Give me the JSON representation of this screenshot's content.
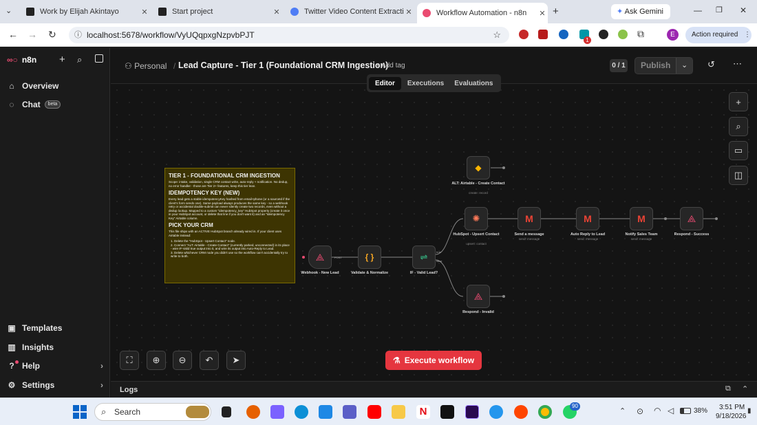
{
  "browser": {
    "tabs": [
      {
        "label": "Work by Elijah Akintayo",
        "icon": "layout-icon"
      },
      {
        "label": "Start project",
        "icon": "layout-icon"
      },
      {
        "label": "Twitter Video Content Extractio",
        "icon": "gemini-icon"
      },
      {
        "label": "Workflow Automation - n8n",
        "icon": "n8n-icon"
      }
    ],
    "ask_gemini": "Ask Gemini",
    "url": "localhost:5678/workflow/VyUQqpxgNzpvbPJT",
    "profile_initial": "E",
    "action_required": "Action required",
    "ext_badge": "1"
  },
  "colors": {
    "accent": "#ea4b71",
    "execute": "#e5363f",
    "note_bg": "#3d3402"
  },
  "sidebar": {
    "logo": "n8n",
    "items": [
      {
        "label": "Overview",
        "icon": "home-icon"
      },
      {
        "label": "Chat",
        "icon": "chat-icon"
      }
    ],
    "beta": "beta",
    "bottom": [
      {
        "label": "Templates",
        "icon": "templates-icon"
      },
      {
        "label": "Insights",
        "icon": "insights-icon"
      },
      {
        "label": "Help",
        "icon": "help-icon"
      },
      {
        "label": "Settings",
        "icon": "settings-icon"
      }
    ]
  },
  "header": {
    "project": "Personal",
    "workflow_name": "Lead Capture - Tier 1 (Foundational CRM Ingestion)",
    "add_tag": "+ Add tag",
    "counter": "0 / 1",
    "publish": "Publish",
    "tabs": [
      "Editor",
      "Executions",
      "Evaluations"
    ],
    "active_tab": "Editor"
  },
  "note": {
    "h1": "TIER 1 - FOUNDATIONAL CRM INGESTION",
    "p1": "Scope: intake, validation, single CRM contact write, auto-reply + notification. No dedup, no error handler - those are Tier 2+ features, keep this tier lean.",
    "h2": "IDEMPOTENCY KEY (NEW)",
    "p2": "Every lead gets a stable idempotencyKey hashed from email+phone (or a sourceId if the client's form sends one). Same payload always produces the same key - so a webhook retry or accidental double-submit can never silently create two records, even without a dedup lookup. Mapped to a custom \"idempotency_key\" HubSpot property (create it once in your HubSpot account, or delete that line if you don't want it) and an \"Idempotency Key\" Airtable column.",
    "h3": "PICK YOUR CRM",
    "p3": "This file ships with an ACTIVE HubSpot branch already wired in. If your client uses Airtable instead:",
    "steps": [
      "1. Delete the \"HubSpot - Upsert Contact\" node.",
      "2. Connect \"ALT: Airtable - Create Contact\" (currently parked, unconnected) in its place - wire IF-Valid true output into it, and wire its output into Auto-Reply to Lead.",
      "3. Delete whichever CRM node you didn't use so the workflow can't accidentally try to write to both."
    ]
  },
  "nodes": [
    {
      "label": "Webhook - New Lead",
      "sub": ""
    },
    {
      "label": "Validate & Normalize",
      "sub": ""
    },
    {
      "label": "IF - Valid Lead?",
      "sub": ""
    },
    {
      "label": "ALT: Airtable - Create Contact",
      "sub": "create: record"
    },
    {
      "label": "HubSpot - Upsert Contact",
      "sub": "upsert: contact"
    },
    {
      "label": "Send a message",
      "sub": "send: message"
    },
    {
      "label": "Auto Reply to Lead",
      "sub": "send: message"
    },
    {
      "label": "Notify Sales Team",
      "sub": "send: message"
    },
    {
      "label": "Respond - Success",
      "sub": ""
    },
    {
      "label": "Respond - Invalid",
      "sub": ""
    }
  ],
  "edge_labels": {
    "post": "POST",
    "true": "true",
    "false": "false"
  },
  "execute": "Execute workflow",
  "logs": "Logs",
  "taskbar": {
    "search": "Search",
    "time": "3:51 PM",
    "date": "9/18/2026",
    "battery": "38%",
    "whatsapp_badge": "90"
  }
}
